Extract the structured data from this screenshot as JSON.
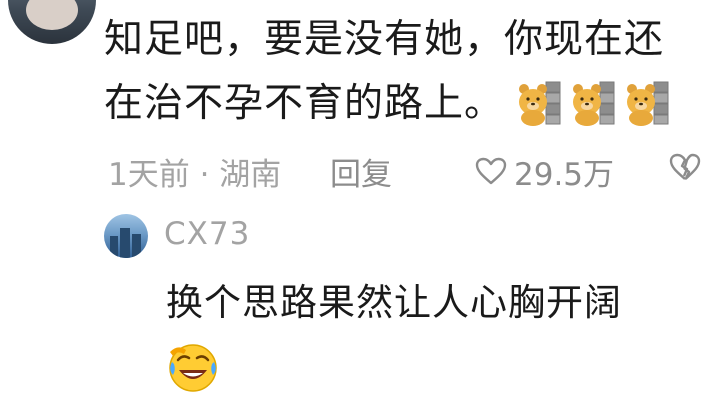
{
  "comment": {
    "text_line1": "知足吧，要是没有她，你现在还",
    "text_line2": "在治不孕不育的路上。",
    "emojis": [
      "bear-wall-icon",
      "bear-wall-icon",
      "bear-wall-icon"
    ],
    "time_location": "1天前 · 湖南",
    "reply_label": "回复",
    "like_count": "29.5万"
  },
  "reply": {
    "username": "CX73",
    "text": "换个思路果然让人心胸开阔",
    "emoji": "laughing-tears-icon"
  },
  "colors": {
    "text_primary": "#1a1a1a",
    "text_secondary": "#a3a3a3",
    "background": "#ffffff"
  }
}
